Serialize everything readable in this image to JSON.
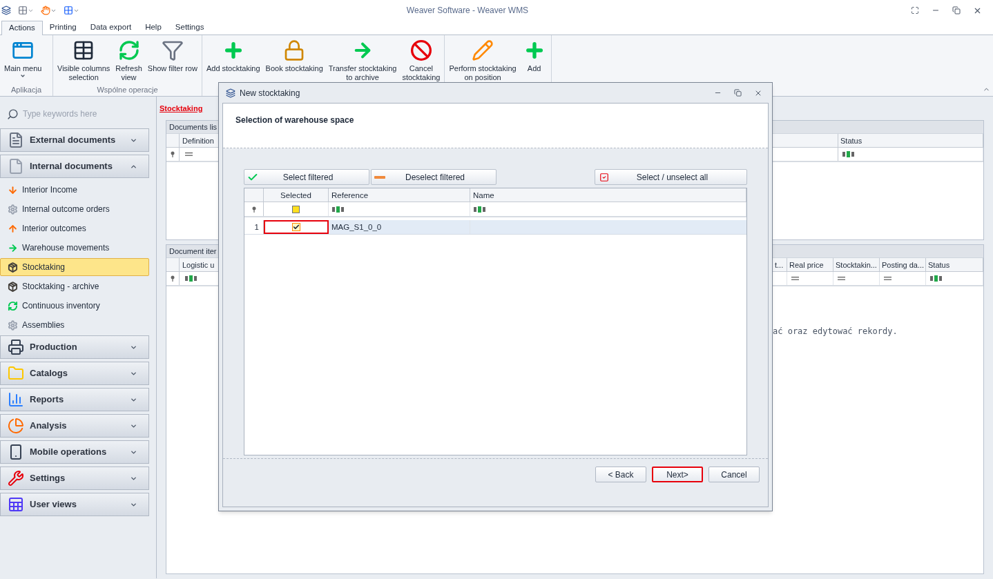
{
  "window": {
    "title": "Weaver Software - Weaver WMS"
  },
  "ribbon": {
    "tabs": [
      {
        "label": "Actions",
        "selected": true
      },
      {
        "label": "Printing",
        "selected": false
      },
      {
        "label": "Data export",
        "selected": false
      },
      {
        "label": "Help",
        "selected": false
      },
      {
        "label": "Settings",
        "selected": false
      }
    ],
    "groups": [
      {
        "label": "Aplikacja",
        "buttons": [
          {
            "label": "Main menu",
            "dropdown": true
          }
        ]
      },
      {
        "label": "Wspólne operacje",
        "buttons": [
          {
            "label": "Visible columns\nselection",
            "dropdown": false
          },
          {
            "label": "Refresh\nview",
            "dropdown": false
          },
          {
            "label": "Show filter row",
            "dropdown": false
          }
        ]
      },
      {
        "buttons": [
          {
            "label": "Add stocktaking",
            "dropdown": false
          },
          {
            "label": "Book stocktaking",
            "dropdown": false
          },
          {
            "label": "Transfer stocktaking\nto archive",
            "dropdown": false
          },
          {
            "label": "Cancel\nstocktaking",
            "dropdown": false
          }
        ]
      },
      {
        "buttons": [
          {
            "label": "Perform stocktaking\non position",
            "dropdown": false
          },
          {
            "label": "Add",
            "dropdown": false
          }
        ]
      }
    ]
  },
  "sidebar": {
    "search": {
      "placeholder": "Type keywords here"
    },
    "groups": [
      {
        "label": "External documents",
        "expanded": false
      },
      {
        "label": "Internal documents",
        "expanded": true,
        "items": [
          {
            "label": "Interior Income",
            "selected": false
          },
          {
            "label": "Internal outcome orders",
            "selected": false
          },
          {
            "label": "Interior outcomes",
            "selected": false
          },
          {
            "label": "Warehouse movements",
            "selected": false
          },
          {
            "label": "Stocktaking",
            "selected": true
          },
          {
            "label": "Stocktaking - archive",
            "selected": false
          },
          {
            "label": "Continuous inventory",
            "selected": false
          },
          {
            "label": "Assemblies",
            "selected": false
          }
        ]
      },
      {
        "label": "Production",
        "expanded": false
      },
      {
        "label": "Catalogs",
        "expanded": false
      },
      {
        "label": "Reports",
        "expanded": false
      },
      {
        "label": "Analysis",
        "expanded": false
      },
      {
        "label": "Mobile operations",
        "expanded": false
      },
      {
        "label": "Settings",
        "expanded": false
      },
      {
        "label": "User views",
        "expanded": false
      }
    ]
  },
  "content": {
    "breadcrumb": "Stocktaking",
    "documents_list": {
      "title": "Documents lis",
      "columns_left": [
        {
          "label": "Definition"
        }
      ],
      "filters_left": [
        {
          "kind": "equals"
        }
      ],
      "columns_right": [
        {
          "label": "Status"
        }
      ],
      "filters_right": [
        {
          "kind": "text"
        }
      ]
    },
    "document_items": {
      "title": "Document iter",
      "columns_left": [
        {
          "label": "Logistic u"
        }
      ],
      "filters_left": [
        {
          "kind": "text"
        }
      ],
      "columns_right": [
        {
          "label": "t..."
        },
        {
          "label": "Real price"
        },
        {
          "label": "Stocktakin..."
        },
        {
          "label": "Posting da..."
        },
        {
          "label": "Status"
        }
      ],
      "filters_right": [
        {
          "kind": "blank"
        },
        {
          "kind": "equals"
        },
        {
          "kind": "equals"
        },
        {
          "kind": "equals"
        },
        {
          "kind": "text"
        }
      ],
      "message": "ać oraz edytować rekordy."
    }
  },
  "dialog": {
    "title": "New stocktaking",
    "heading": "Selection of warehouse space",
    "actions": [
      {
        "label": "Select filtered"
      },
      {
        "label": "Deselect filtered"
      },
      {
        "label": "Select / unselect all"
      }
    ],
    "columns": [
      {
        "label": "Selected"
      },
      {
        "label": "Reference"
      },
      {
        "label": "Name"
      }
    ],
    "filters": [
      {
        "kind": "checkbox",
        "checked": false
      },
      {
        "kind": "text"
      },
      {
        "kind": "text"
      }
    ],
    "rows": [
      {
        "number": "1",
        "checked": true,
        "highlighted": true,
        "reference": "MAG_S1_0_0"
      }
    ],
    "footer_buttons": [
      {
        "label": "< Back",
        "highlighted": false
      },
      {
        "label": "Next>",
        "highlighted": true
      },
      {
        "label": "Cancel",
        "highlighted": false
      }
    ]
  }
}
